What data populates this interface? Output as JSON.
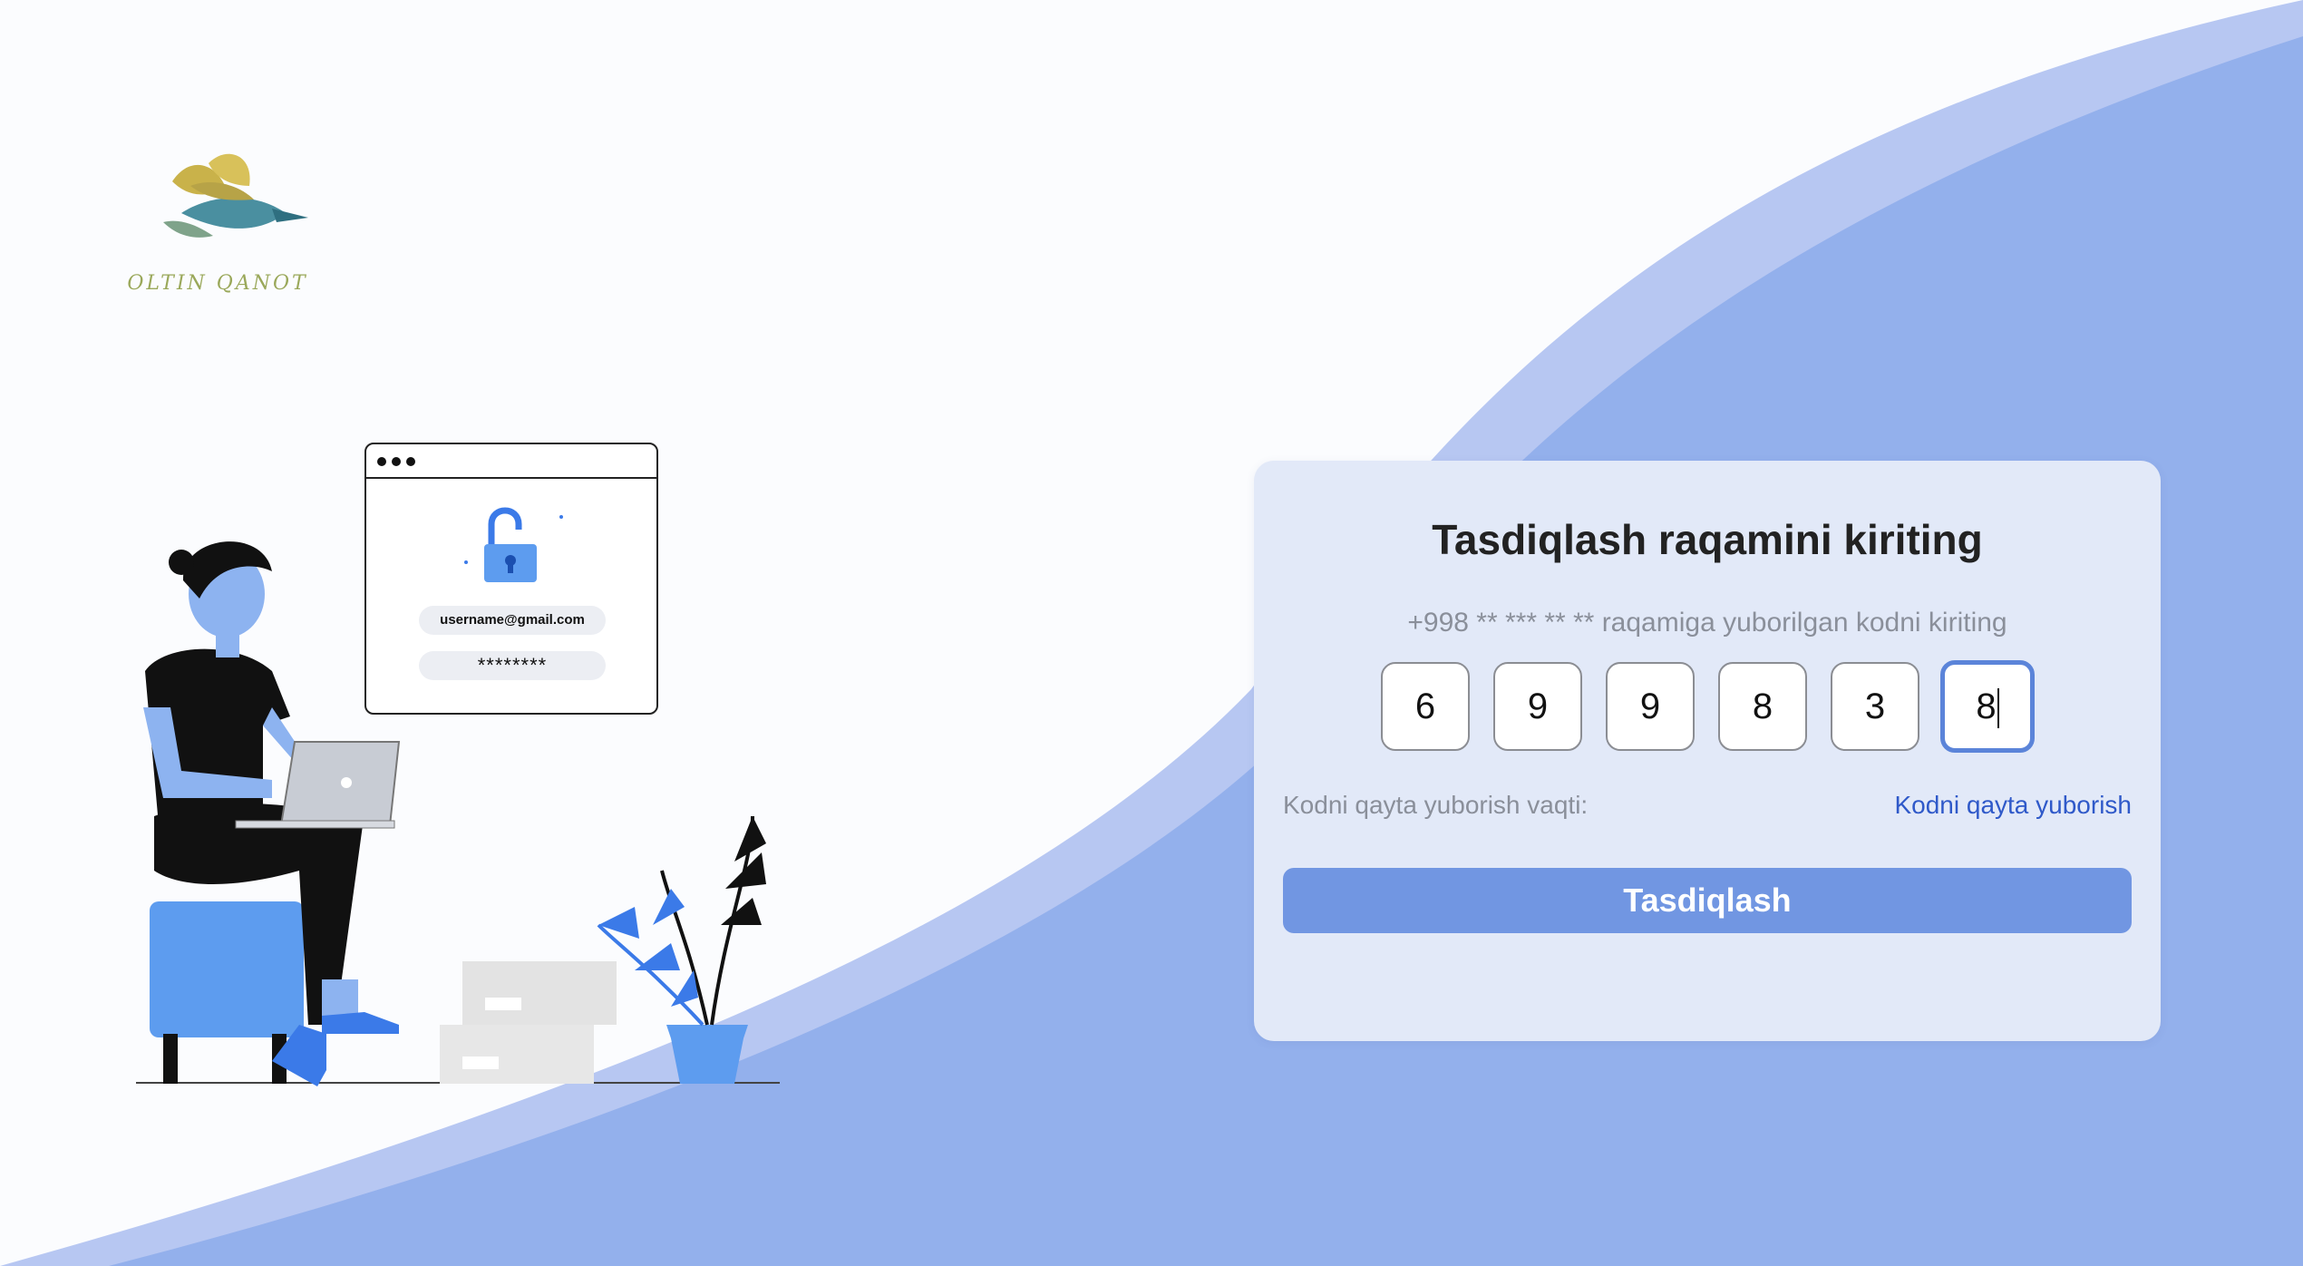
{
  "brand": {
    "logo_text": "OLTIN QANOT"
  },
  "illustration": {
    "email": "username@gmail.com",
    "password_mask": "********"
  },
  "card": {
    "title": "Tasdiqlash raqamini kiriting",
    "subtitle": "+998 ** *** ** ** raqamiga yuborilgan kodni kiriting",
    "otp_digits": [
      "6",
      "9",
      "9",
      "8",
      "3",
      "8"
    ],
    "resend_label": "Kodni qayta yuborish vaqti:",
    "resend_link": "Kodni qayta yuborish",
    "submit_label": "Tasdiqlash"
  },
  "colors": {
    "background": "#fbfcfe",
    "wave_light": "#b7c7f2",
    "wave_main": "#93b0ec",
    "card": "#e2e9f8",
    "button": "#7196e2",
    "link": "#2f59c9",
    "active_border": "#5b84d9"
  }
}
